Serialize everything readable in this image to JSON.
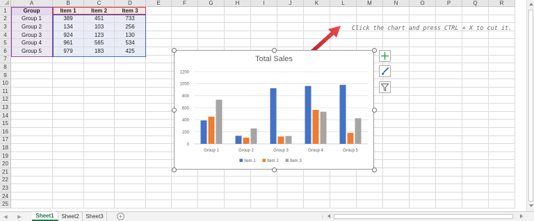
{
  "columns": [
    "A",
    "B",
    "C",
    "D",
    "E",
    "F",
    "G",
    "H",
    "I",
    "J",
    "K",
    "L",
    "M",
    "N",
    "O",
    "P",
    "Q",
    "R"
  ],
  "rows": [
    "1",
    "2",
    "3",
    "4",
    "5",
    "6",
    "7",
    "8",
    "9",
    "10",
    "11",
    "12",
    "13",
    "14",
    "15",
    "16",
    "17",
    "18",
    "19",
    "20",
    "21",
    "22",
    "23",
    "24",
    "25"
  ],
  "table": {
    "header": [
      "Group",
      "Item 1",
      "Item 2",
      "Item 3"
    ],
    "rows": [
      [
        "Group 1",
        "389",
        "451",
        "733"
      ],
      [
        "Group 2",
        "134",
        "103",
        "256"
      ],
      [
        "Group 3",
        "924",
        "123",
        "130"
      ],
      [
        "Group 4",
        "961",
        "565",
        "534"
      ],
      [
        "Group 5",
        "979",
        "183",
        "425"
      ]
    ]
  },
  "annotation": "Click the chart and press CTRL + X to cut it.",
  "chart_data": {
    "type": "bar",
    "title": "Total Sales",
    "categories": [
      "Group 1",
      "Group 2",
      "Group 3",
      "Group 4",
      "Group 5"
    ],
    "series": [
      {
        "name": "Item 1",
        "values": [
          389,
          134,
          924,
          961,
          979
        ],
        "color": "#4472c4"
      },
      {
        "name": "Item 2",
        "values": [
          451,
          103,
          123,
          565,
          183
        ],
        "color": "#ed7d31"
      },
      {
        "name": "Item 3",
        "values": [
          733,
          256,
          130,
          534,
          425
        ],
        "color": "#a5a5a5"
      }
    ],
    "ylim": [
      0,
      1200
    ],
    "yticks": [
      "0",
      "200",
      "400",
      "600",
      "800",
      "1000",
      "1200"
    ],
    "grid": true,
    "legend": "bottom"
  },
  "chart_buttons": [
    "chart-elements-plus-icon",
    "chart-styles-brush-icon",
    "chart-filters-funnel-icon"
  ],
  "sheets": {
    "tabs": [
      "Sheet1",
      "Sheet2",
      "Sheet3"
    ],
    "active": "Sheet1",
    "add_icon": "plus-circle-icon"
  },
  "colors": {
    "accent_green": "#217346",
    "arrow_red": "#d9242b"
  }
}
